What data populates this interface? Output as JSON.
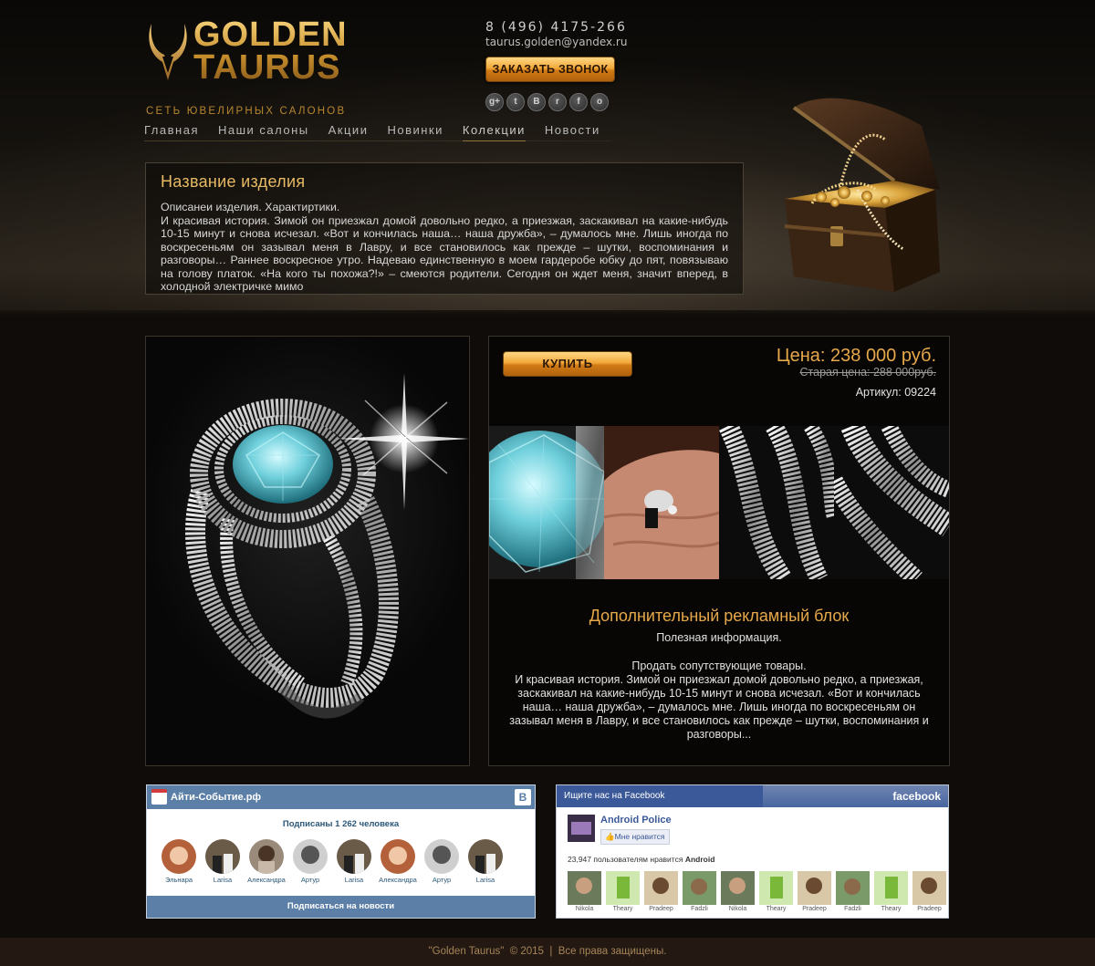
{
  "header": {
    "logo": {
      "line1": "GOLDEN",
      "line2": "TAURUS",
      "tagline": "СЕТЬ ЮВЕЛИРНЫХ САЛОНОВ"
    },
    "phone": "8 (496) 4175-266",
    "email": "taurus.golden@yandex.ru",
    "callback_label": "ЗАКАЗАТЬ ЗВОНОК",
    "social_icons": [
      "google-plus-icon",
      "twitter-icon",
      "vk-icon",
      "rss-icon",
      "facebook-icon",
      "odnoklassniki-icon"
    ],
    "social_glyphs": [
      "g+",
      "t",
      "В",
      "r",
      "f",
      "o"
    ]
  },
  "nav": {
    "items": [
      "Главная",
      "Наши салоны",
      "Акции",
      "Новинки",
      "Колекции",
      "Новости"
    ],
    "active_index": 4
  },
  "product": {
    "title": "Название изделия",
    "description": "Описанеи изделия. Характиртики.\nИ красивая история.  Зимой он приезжал домой довольно редко, а приезжая, заскакивал на какие-нибудь 10-15 минут и снова исчезал. «Вот и кончилась наша… наша дружба», – думалось мне. Лишь иногда по воскресеньям он зазывал меня в Лавру, и все становилось как прежде – шутки, воспоминания и разговоры… Раннее воскресное утро. Надеваю единственную в моем гардеробе юбку до пят, повязываю на голову платок. «На кого ты похожа?!» – смеются родители. Сегодня он ждет меня, значит вперед, в холодной электричке мимо"
  },
  "purchase": {
    "buy_label": "КУПИТЬ",
    "price": "Цена: 238 000 руб.",
    "old_price": "Старая цена: 288 000руб.",
    "article": "Артикул: 09224"
  },
  "ad": {
    "title": "Дополнительный рекламный блок",
    "subtitle": "Полезная информация.",
    "text": "Продать сопутствующие товары.\nИ красивая история.  Зимой он приезжал домой довольно редко, а приезжая, заскакивал на какие-нибудь 10-15 минут и снова исчезал. «Вот и кончилась наша… наша дружба», – думалось мне. Лишь иногда по воскресеньям он зазывал меня в Лавру, и все становилось как прежде – шутки, воспоминания и разговоры..."
  },
  "vk_widget": {
    "title": "Айти-Событие.рф",
    "count": "Подписаны 1 262 человека",
    "members": [
      "Эльнара",
      "Larisa",
      "Александра",
      "Артур",
      "Larisa",
      "Александра",
      "Артур",
      "Larisa"
    ],
    "subscribe_label": "Подписаться на новости"
  },
  "fb_widget": {
    "title": "Ищите нас на Facebook",
    "logo": "facebook",
    "page_name": "Android Police",
    "like_label": "Мне нравится",
    "count_text": "23,947 пользователям нравится",
    "count_page": "Android",
    "faces": [
      "Nikola",
      "Theary",
      "Pradeep",
      "Fadzli",
      "Nikola",
      "Theary",
      "Pradeep",
      "Fadzli",
      "Theary",
      "Pradeep"
    ]
  },
  "footer": {
    "text": "\"Golden Taurus\"  © 2015  |  Все права защищены."
  },
  "colors": {
    "gold": "#e7ba63",
    "vk_blue": "#5b7fa6",
    "fb_blue": "#3b5998",
    "footer_bg": "#231912"
  }
}
